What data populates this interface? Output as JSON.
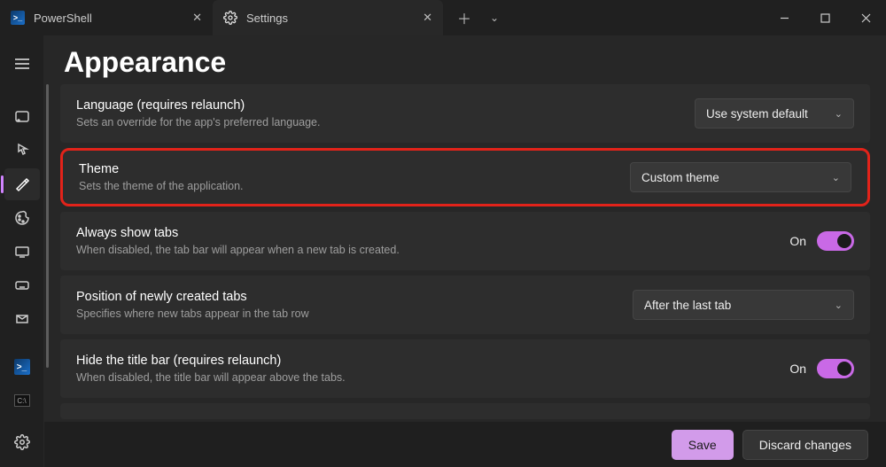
{
  "tabs": {
    "powershell": "PowerShell",
    "settings": "Settings"
  },
  "nav": {
    "tooltips": [
      "Menu",
      "Default",
      "Interaction",
      "Appearance",
      "Color",
      "Rendering",
      "Actions",
      "Profiles",
      "Azure",
      "Command Prompt"
    ]
  },
  "page": {
    "title": "Appearance"
  },
  "rows": {
    "language": {
      "title": "Language (requires relaunch)",
      "desc": "Sets an override for the app's preferred language.",
      "value": "Use system default"
    },
    "theme": {
      "title": "Theme",
      "desc": "Sets the theme of the application.",
      "value": "Custom theme"
    },
    "showtabs": {
      "title": "Always show tabs",
      "desc": "When disabled, the tab bar will appear when a new tab is created.",
      "state": "On"
    },
    "tabpos": {
      "title": "Position of newly created tabs",
      "desc": "Specifies where new tabs appear in the tab row",
      "value": "After the last tab"
    },
    "hidetitle": {
      "title": "Hide the title bar (requires relaunch)",
      "desc": "When disabled, the title bar will appear above the tabs.",
      "state": "On"
    }
  },
  "footer": {
    "save": "Save",
    "discard": "Discard changes"
  }
}
